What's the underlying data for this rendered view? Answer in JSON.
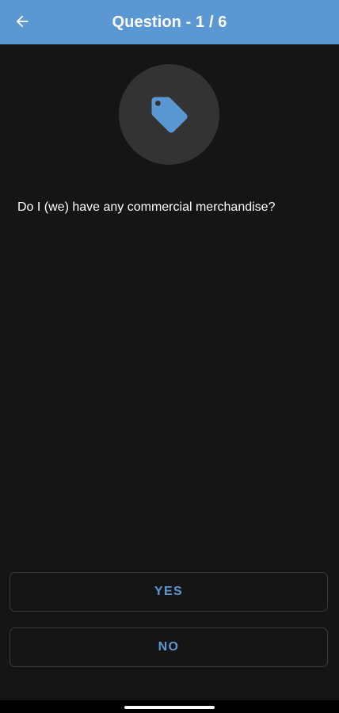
{
  "header": {
    "title": "Question - 1 / 6",
    "background_color": "#5b98d3",
    "back_icon": "arrow-left-icon"
  },
  "question": {
    "icon": "tag-icon",
    "text": "Do I (we) have any commercial merchandise?"
  },
  "answers": {
    "yes_label": "YES",
    "no_label": "NO",
    "accent_color": "#5b98d3"
  },
  "colors": {
    "background": "#151515",
    "icon_circle": "#333333",
    "button_border": "#3a3a3a"
  }
}
